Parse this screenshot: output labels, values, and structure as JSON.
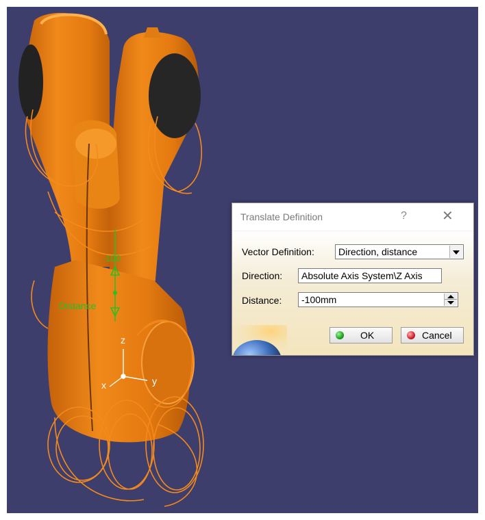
{
  "viewport": {
    "background": "#3e3e6c",
    "part_color": "#e07d12",
    "wire_color": "#f07d10",
    "dim_color": "#22c322",
    "dimension_value": "-100",
    "dimension_label": "Distance",
    "axis_x": "x",
    "axis_y": "y",
    "axis_z": "z"
  },
  "dialog": {
    "title": "Translate Definition",
    "help": "?",
    "close": "✕",
    "vector_definition_label": "Vector Definition:",
    "vector_definition_value": "Direction, distance",
    "direction_label": "Direction:",
    "direction_value": "Absolute Axis System\\Z Axis",
    "distance_label": "Distance:",
    "distance_value": "-100mm",
    "ok_label": "OK",
    "cancel_label": "Cancel",
    "ok_color": "#1ea01e",
    "cancel_color": "#d0202a"
  }
}
